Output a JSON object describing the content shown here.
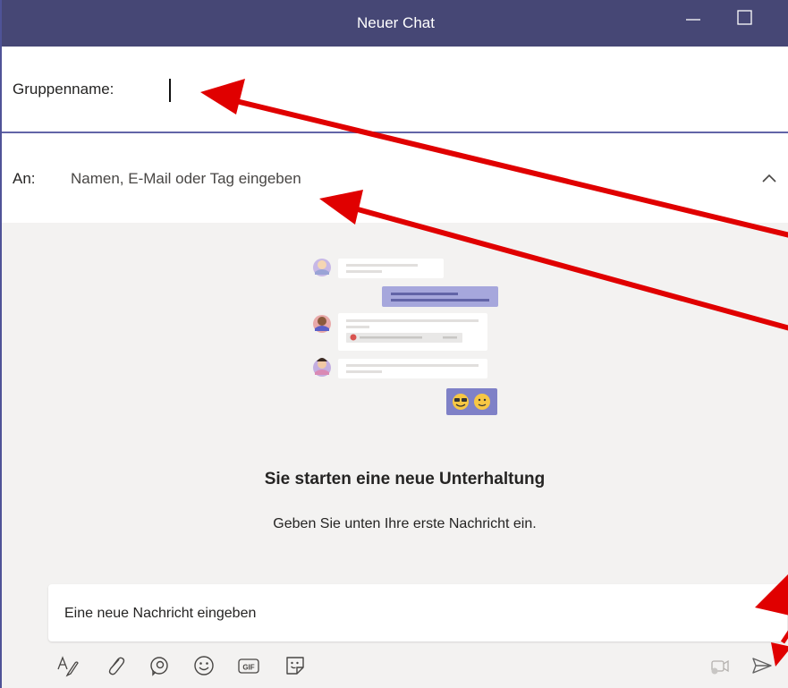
{
  "window": {
    "title": "Neuer Chat",
    "colors": {
      "titlebar": "#464775",
      "accent": "#6264a7",
      "background": "#f3f2f1"
    }
  },
  "group": {
    "label": "Gruppenname:",
    "value": ""
  },
  "to": {
    "label": "An:",
    "placeholder": "Namen, E-Mail oder Tag eingeben"
  },
  "conversation": {
    "title": "Sie starten eine neue Unterhaltung",
    "subtitle": "Geben Sie unten Ihre erste Nachricht ein."
  },
  "compose": {
    "placeholder": "Eine neue Nachricht eingeben"
  },
  "toolbar": {
    "icons": [
      "format-icon",
      "attach-icon",
      "loop-icon",
      "emoji-icon",
      "gif-icon",
      "sticker-icon",
      "meet-now-icon",
      "send-icon"
    ],
    "gif_label": "GIF"
  },
  "annotations": {
    "arrow_color": "#e00000"
  }
}
